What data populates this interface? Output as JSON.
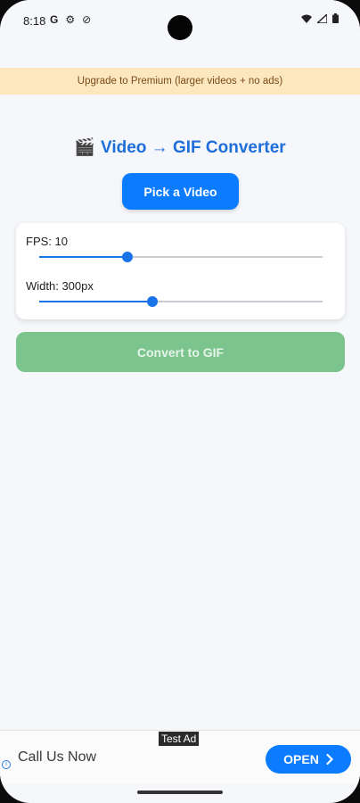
{
  "status_bar": {
    "time": "8:18",
    "left_icons": [
      "google-g-icon",
      "settings-icon",
      "blocked-icon"
    ],
    "right_icons": [
      "wifi-icon",
      "signal-icon",
      "battery-icon"
    ]
  },
  "banner": {
    "text": "Upgrade to Premium (larger videos + no ads)"
  },
  "title": {
    "emoji": "🎬",
    "text": "Video → GIF Converter",
    "color": "#1e6fd9"
  },
  "pick_button": {
    "label": "Pick a Video",
    "color": "#0b7bff"
  },
  "settings": {
    "fps": {
      "label": "FPS: 10",
      "fraction": 0.31
    },
    "width": {
      "label": "Width: 300px",
      "fraction": 0.4
    }
  },
  "convert_button": {
    "label": "Convert to GIF",
    "enabled": false,
    "color": "#7cc48d"
  },
  "ad": {
    "tag": "Test Ad",
    "text": "Call Us Now",
    "cta": "OPEN"
  }
}
